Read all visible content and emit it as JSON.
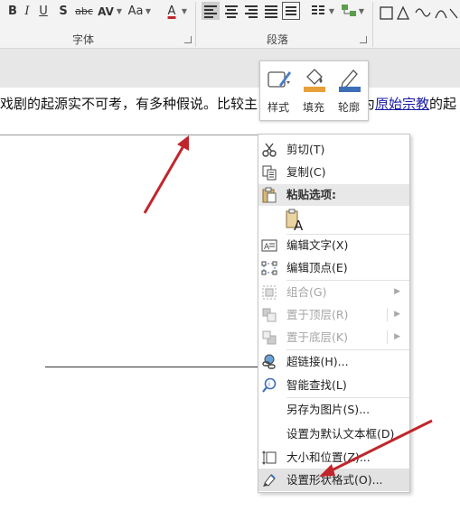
{
  "ribbon": {
    "font_buttons": [
      "B",
      "I",
      "U",
      "S",
      "abc",
      "AV",
      "Aa",
      "A"
    ],
    "font_group_label": "字体",
    "paragraph_group_label": "段落"
  },
  "document": {
    "text_before": "戏剧的起源实不可考，有多种假说。比较主",
    "text_hidden_end": "一为",
    "link_text": "原始宗教",
    "text_after": "的起"
  },
  "mini_toolbar": {
    "style_label": "样式",
    "fill_label": "填充",
    "outline_label": "轮廓"
  },
  "context_menu": {
    "cut": "剪切(T)",
    "copy": "复制(C)",
    "paste_options": "粘贴选项:",
    "edit_text": "编辑文字(X)",
    "edit_points": "编辑顶点(E)",
    "group": "组合(G)",
    "bring_front": "置于顶层(R)",
    "send_back": "置于底层(K)",
    "hyperlink": "超链接(H)...",
    "smart_lookup": "智能查找(L)",
    "save_as_picture": "另存为图片(S)...",
    "set_default_textbox": "设置为默认文本框(D)",
    "size_position": "大小和位置(Z)...",
    "format_shape": "设置形状格式(O)..."
  },
  "colors": {
    "accent_red": "#c0262c",
    "fill_orange": "#e8a13a",
    "outline_blue": "#3d6fb7",
    "menu_highlight": "#e2e2e2"
  },
  "icons": {
    "cut": "scissors-icon",
    "copy": "copy-icon",
    "paste": "clipboard-icon",
    "edit_text": "textbox-icon",
    "edit_points": "edit-points-icon",
    "group": "group-icon",
    "hyperlink": "link-icon",
    "smart_lookup": "search-icon",
    "size_position": "size-icon",
    "format_shape": "format-shape-icon"
  }
}
